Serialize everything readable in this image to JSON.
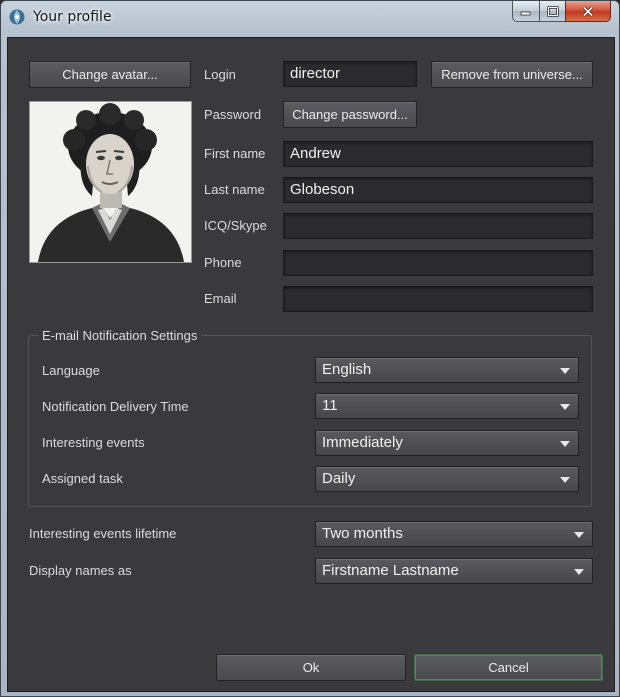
{
  "window": {
    "title": "Your profile",
    "icon": "app-logo-icon",
    "controls": {
      "minimize": "minimize-icon",
      "maximize": "maximize-icon",
      "close": "close-icon"
    }
  },
  "profile": {
    "change_avatar_label": "Change avatar...",
    "login_label": "Login",
    "login_value": "director",
    "remove_label": "Remove from universe...",
    "password_label": "Password",
    "change_password_label": "Change password...",
    "first_name_label": "First name",
    "first_name_value": "Andrew",
    "last_name_label": "Last name",
    "last_name_value": "Globeson",
    "icq_label": "ICQ/Skype",
    "icq_value": "",
    "phone_label": "Phone",
    "phone_value": "",
    "email_label": "Email",
    "email_value": ""
  },
  "notifications": {
    "group_title": "E-mail Notification Settings",
    "language_label": "Language",
    "language_value": "English",
    "delivery_label": "Notification Delivery Time",
    "delivery_value": "11",
    "interesting_label": "Interesting events",
    "interesting_value": "Immediately",
    "assigned_label": "Assigned task",
    "assigned_value": "Daily"
  },
  "general": {
    "lifetime_label": "Interesting events lifetime",
    "lifetime_value": "Two months",
    "display_label": "Display names as",
    "display_value": "Firstname Lastname"
  },
  "footer": {
    "ok_label": "Ok",
    "cancel_label": "Cancel"
  },
  "colors": {
    "window_bg": "#3a3a3d",
    "field_bg": "#2b2b2e",
    "button_bg": "#4f4f53",
    "accent_border": "#4d8a5c"
  }
}
